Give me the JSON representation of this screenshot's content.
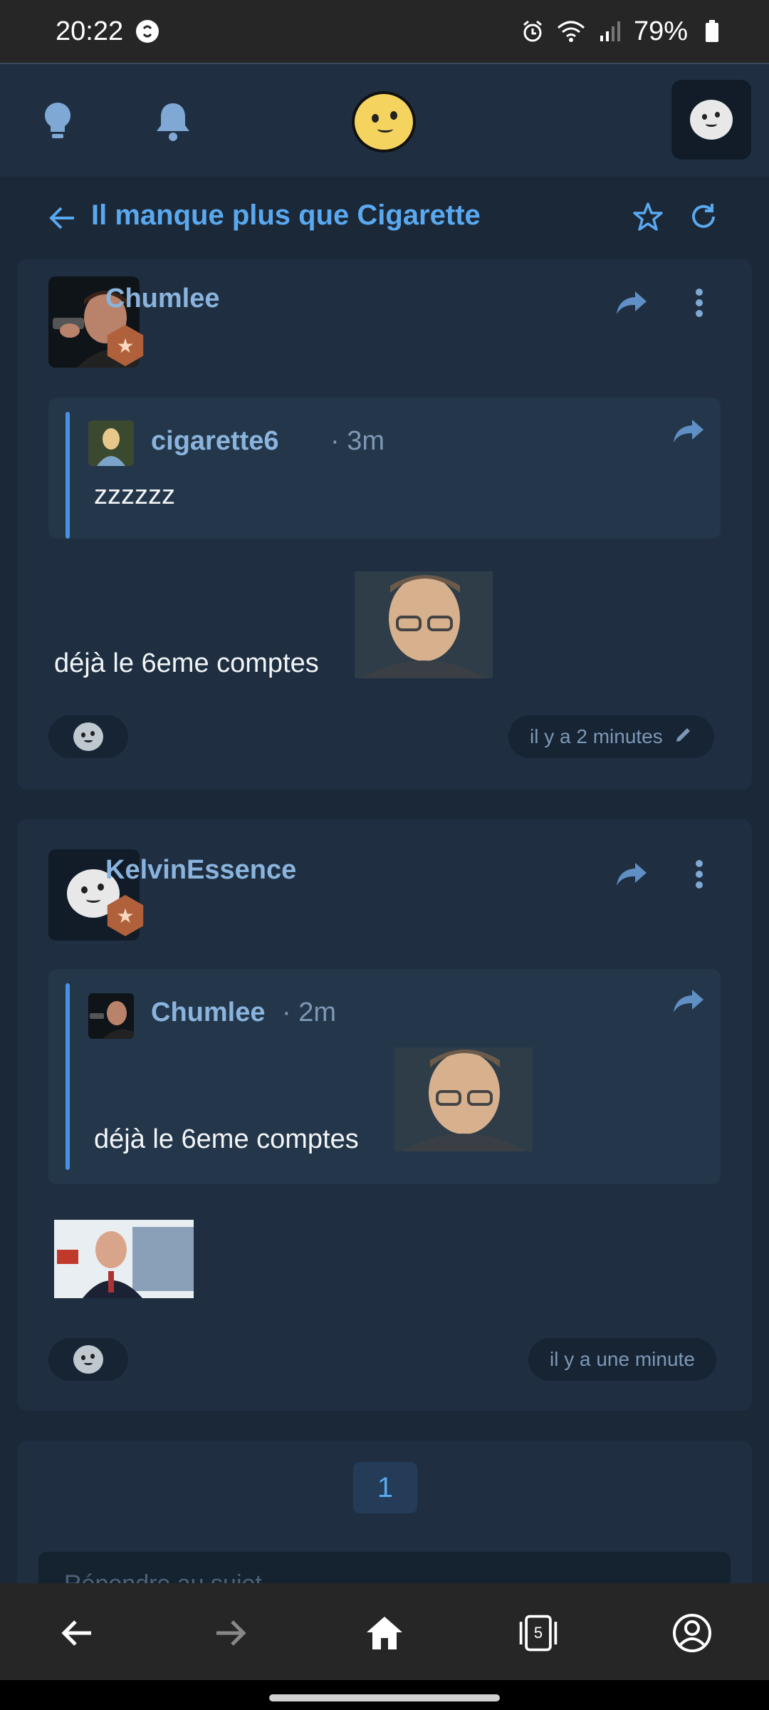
{
  "status_bar": {
    "time": "20:22",
    "battery": "79%"
  },
  "thread": {
    "title": "Il manque plus que Cigarette"
  },
  "posts": [
    {
      "author": "Chumlee",
      "quote": {
        "author": "cigarette6",
        "time": "3m",
        "text": "zzzzzz"
      },
      "text": "déjà le 6eme comptes",
      "timestamp": "il y a 2 minutes"
    },
    {
      "author": "KelvinEssence",
      "quote": {
        "author": "Chumlee",
        "time": "2m",
        "text": "déjà le 6eme comptes"
      },
      "timestamp": "il y a une minute"
    }
  ],
  "pagination": {
    "current_page": "1"
  },
  "reply": {
    "placeholder": "Répondre au sujet"
  },
  "tabs_count": "5",
  "colors": {
    "background": "#1b2838",
    "card": "#1f2f41",
    "accent": "#5aa8ee",
    "username": "#8ab4dd",
    "badge": "#b0603a"
  }
}
